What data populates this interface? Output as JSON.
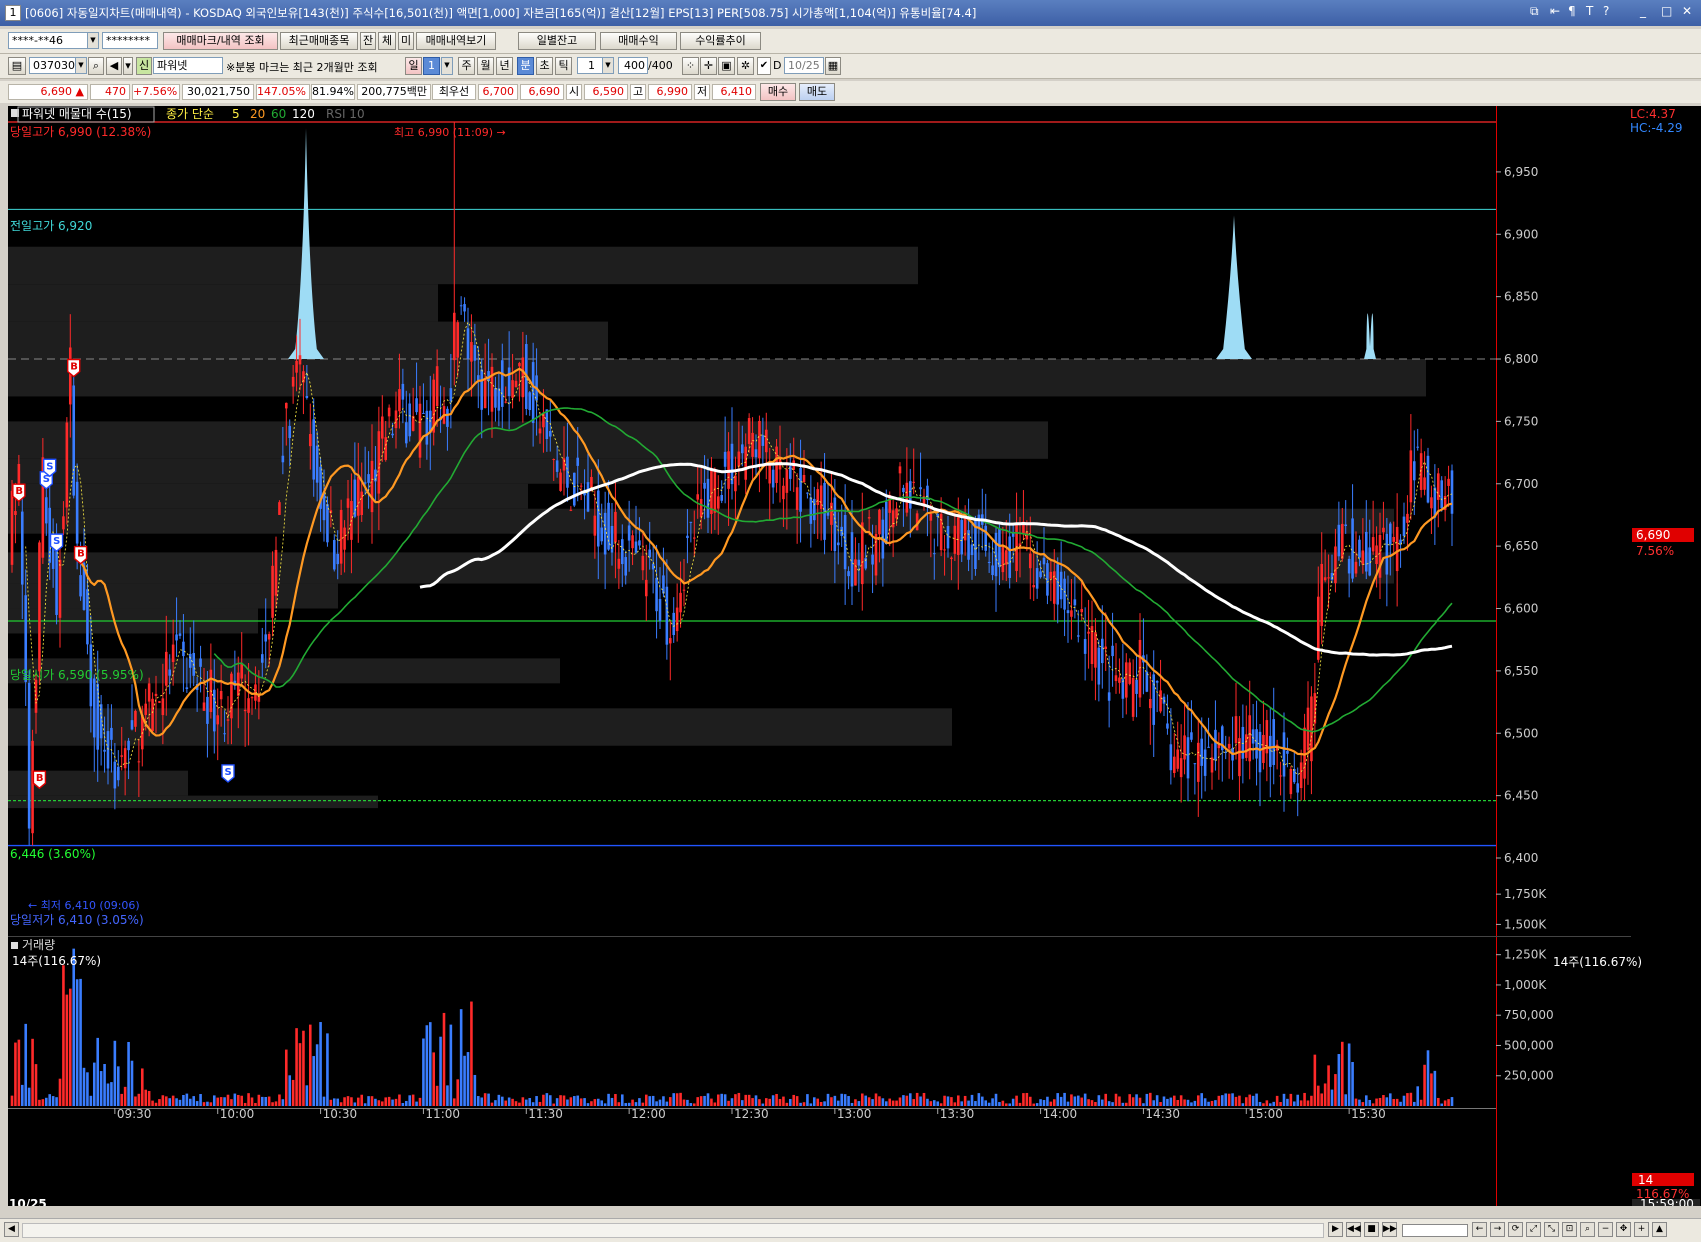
{
  "window": {
    "id": "1",
    "title": "[0606] 자동일지차트(매매내역) - KOSDAQ 외국인보유[143(천)] 주식수[16,501(천)] 액면[1,000] 자본금[165(억)] 결산[12월] EPS[13] PER[508.75] 시가총액[1,104(억)] 유통비율[74.4]",
    "controls": [
      "⧉",
      "⇤",
      "¶",
      "T",
      "?",
      "_",
      "□",
      "✕"
    ]
  },
  "toolbar1": {
    "account": "****-**46",
    "password": "********",
    "buttons": [
      "매매마크/내역 조회",
      "최근매매종목",
      "잔",
      "체",
      "미",
      "매매내역보기",
      "일별잔고",
      "매매수익",
      "수익률추이"
    ]
  },
  "toolbar2": {
    "code": "037030",
    "stock_badge": "신",
    "stock_name": "파워넷",
    "note": "※분봉 마크는 최근 2개월만 조회",
    "period_tabs": [
      "일",
      "1",
      "주",
      "월",
      "년",
      "분",
      "초",
      "틱"
    ],
    "interval": "1",
    "count": "400",
    "count_total": "/400",
    "date_checkbox_label": "D",
    "date": "10/25"
  },
  "quote": {
    "price": "6,690",
    "arrow": "▲",
    "change": "470",
    "change_pct": "+7.56%",
    "volume": "30,021,750",
    "vol_ratio": "147.05%",
    "turnover": "81.94%",
    "amount": "200,775백만",
    "best_label": "최우선",
    "ask": "6,700",
    "bid": "6,690",
    "open_label": "시",
    "open": "6,590",
    "high_label": "고",
    "high": "6,990",
    "low_label": "저",
    "low": "6,410",
    "buy_button": "매수",
    "sell_button": "매도"
  },
  "chart_legend": {
    "title": "파워넷 매물대 수(15)",
    "series_label": "종가 단순",
    "ma_periods": [
      "5",
      "20",
      "60",
      "120"
    ],
    "rsi": "RSI 10"
  },
  "right_info": {
    "lc": "LC:4.37",
    "hc": "HC:-4.29",
    "price_tag": "6,690",
    "pct_tag": "7.56%"
  },
  "annotations": {
    "day_high": "당일고가 6,990 (12.38%)",
    "prev_high": "전일고가 6,920",
    "day_open": "당일시가 6,590 (5.95%)",
    "green_level": "6,446 (3.60%)",
    "day_low": "당일저가 6,410 (3.05%)",
    "peak_label": "최고 6,990 (11:09) →",
    "trough_label": "← 최저 6,410 (09:06)"
  },
  "volume_panel": {
    "title": "거래량",
    "subtitle": "14주(116.67%)",
    "right_label": "14주(116.67%)",
    "last_tag": "14",
    "last_pct": "116.67%",
    "last_time": "15:59:00"
  },
  "colors": {
    "bull": "#ff2a2a",
    "bear": "#3a7dff",
    "ma5": "#ffee44",
    "ma20": "#ff9922",
    "ma60": "#22aa33",
    "ma120": "#ffffff",
    "profile": "#1e1e1e",
    "peak": "#9edcf5"
  },
  "chart_data": {
    "type": "candlestick",
    "y_ticks": [
      "6,950",
      "6,900",
      "6,850",
      "6,800",
      "6,750",
      "6,700",
      "6,650",
      "6,600",
      "6,550",
      "6,500",
      "6,450",
      "6,400"
    ],
    "ylim": [
      6400,
      6990
    ],
    "x_date": "10/25",
    "x_ticks": [
      "09:30",
      "10:00",
      "10:30",
      "11:00",
      "11:30",
      "12:00",
      "12:30",
      "13:00",
      "13:30",
      "14:00",
      "14:30",
      "15:00",
      "15:30"
    ],
    "reference_lines": {
      "day_high": 6990,
      "prev_high": 6920,
      "dashed": 6800,
      "day_open": 6590,
      "green": 6446,
      "day_low": 6410
    },
    "trade_marks": [
      {
        "label": "B",
        "time": "09:02",
        "price": 6690
      },
      {
        "label": "S",
        "time": "09:10",
        "price": 6700
      },
      {
        "label": "S",
        "time": "09:11",
        "price": 6710
      },
      {
        "label": "S",
        "time": "09:13",
        "price": 6650
      },
      {
        "label": "B",
        "time": "09:18",
        "price": 6790
      },
      {
        "label": "B",
        "time": "09:20",
        "price": 6640
      },
      {
        "label": "B",
        "time": "09:08",
        "price": 6460
      },
      {
        "label": "S",
        "time": "10:03",
        "price": 6465
      }
    ],
    "volume_ticks": [
      "1,750K",
      "1,500K",
      "1,250K",
      "1,000K",
      "750,000",
      "500,000",
      "250,000"
    ],
    "volume_ylim": [
      0,
      1900000
    ]
  }
}
